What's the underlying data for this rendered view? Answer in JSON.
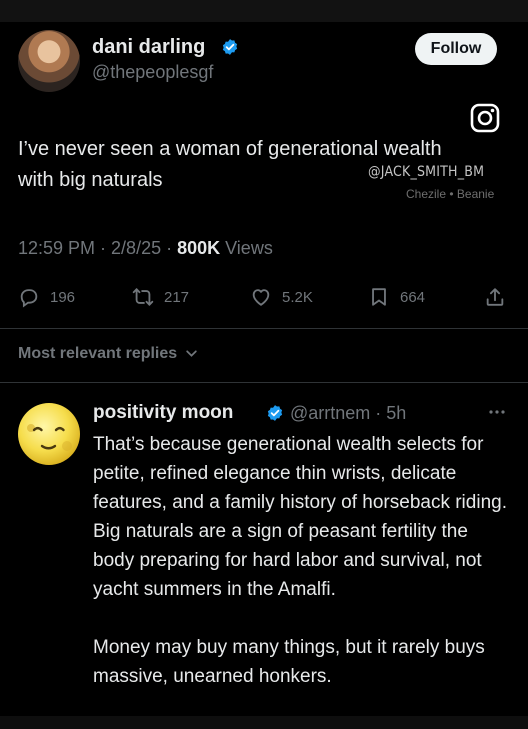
{
  "tweet": {
    "author_name": "dani darling",
    "author_handle": "@thepeoplesgf",
    "follow_label": "Follow",
    "text": "I’ve never seen a woman of generational wealth with big naturals",
    "time": "12:59 PM · 2/8/25 · ",
    "views_count": "800K",
    "views_label": " Views",
    "replies": "196",
    "reposts": "217",
    "likes": "5.2K",
    "bookmarks": "664"
  },
  "watermark": {
    "handle": "@JACK_SMITH_BM",
    "credit": "Chezile • Beanie"
  },
  "replies_header": "Most relevant replies",
  "reply": {
    "name": "positivity moon",
    "handle_time": "@arrtnem · 5h",
    "paragraphs": [
      "That’s because generational wealth selects for petite, refined elegance thin wrists, delicate features, and a family history of horseback riding. Big naturals are a sign of peasant fertility the body preparing for hard labor and survival, not yacht summers in the Amalfi.",
      "Money may buy many things, but it rarely buys massive, unearned honkers."
    ]
  },
  "colors": {
    "background": "#000000",
    "text": "#e7e9ea",
    "muted": "#71767b",
    "verified_blue": "#1d9bf0",
    "follow_bg": "#eff3f4"
  },
  "icons": {
    "verified": "verified-badge-icon",
    "instagram": "instagram-icon",
    "reply": "reply-icon",
    "repost": "repost-icon",
    "like": "heart-icon",
    "bookmark": "bookmark-icon",
    "share": "share-icon",
    "chevron": "chevron-down-icon",
    "more": "more-icon",
    "moon": "moon-emoji-avatar"
  }
}
